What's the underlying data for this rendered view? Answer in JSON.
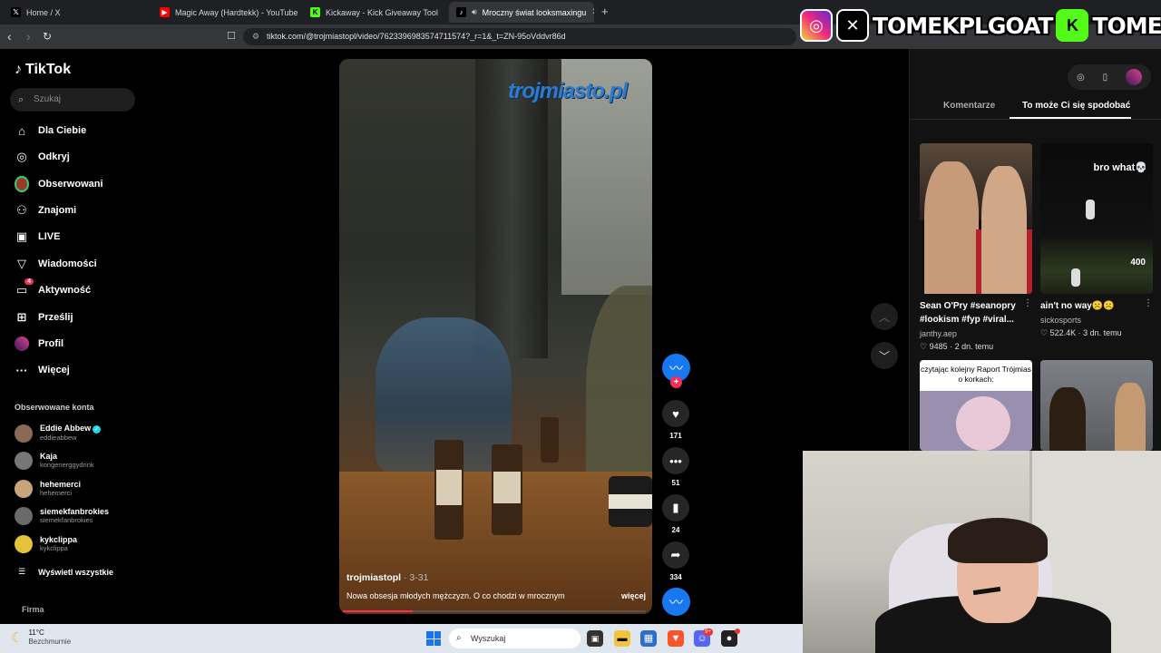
{
  "browser": {
    "tabs": [
      {
        "title": "Home / X",
        "icon": "x-logo-icon",
        "active": false
      },
      {
        "title": "Magic Away (Hardtekk) - YouTube",
        "icon": "youtube-icon",
        "active": false
      },
      {
        "title": "Kickaway - Kick Giveaway Tool",
        "icon": "kick-icon",
        "active": false
      },
      {
        "title": "Mroczny świat looksmaxingu",
        "icon": "tiktok-icon",
        "active": true
      }
    ],
    "url": "tiktok.com/@trojmiastopl/video/7623396983574711574?_r=1&_t=ZN-95oVddvr86d"
  },
  "overlay": {
    "name_x": "TOMEKPLGOAT",
    "name_kick": "TOMEKPL",
    "brand_colors": {
      "kick": "#53fc18",
      "instagram": "#ee2a7b"
    }
  },
  "sidebar": {
    "logo": "TikTok",
    "search_placeholder": "Szukaj",
    "nav": [
      {
        "label": "Dla Ciebie",
        "icon": "home-icon"
      },
      {
        "label": "Odkryj",
        "icon": "compass-icon"
      },
      {
        "label": "Obserwowani",
        "icon": "avatar-icon"
      },
      {
        "label": "Znajomi",
        "icon": "friends-icon"
      },
      {
        "label": "LIVE",
        "icon": "live-icon"
      },
      {
        "label": "Wiadomości",
        "icon": "send-icon"
      },
      {
        "label": "Aktywność",
        "icon": "inbox-icon",
        "badge": "4"
      },
      {
        "label": "Prześlij",
        "icon": "upload-icon"
      },
      {
        "label": "Profil",
        "icon": "profile-icon"
      },
      {
        "label": "Więcej",
        "icon": "more-icon"
      }
    ],
    "followed_title": "Obserwowane konta",
    "accounts": [
      {
        "name": "Eddie Abbew",
        "handle": "eddieabbew",
        "verified": true
      },
      {
        "name": "Kaja",
        "handle": "kongenerggydrink"
      },
      {
        "name": "hehemerci",
        "handle": "hehemerci"
      },
      {
        "name": "siemekfanbrokies",
        "handle": "siemekfanbrokies"
      },
      {
        "name": "kykclippa",
        "handle": "kykclippa"
      }
    ],
    "show_all": "Wyświetl wszystkie",
    "firma": "Firma"
  },
  "video": {
    "watermark": "trojmiasto.pl",
    "author": "trojmiastopl",
    "date": "· 3-31",
    "description": "Nowa obsesja młodych mężczyzn. O co chodzi w mrocznym",
    "more": "więcej",
    "progress": 0.23
  },
  "actions": {
    "likes": "171",
    "comments": "51",
    "saves": "24",
    "shares": "334"
  },
  "right_panel": {
    "tabs": [
      "Komentarze",
      "To może Ci się spodobać"
    ],
    "active_tab": 1,
    "videos": [
      {
        "caption": "Sean O'Pry #seanopry #lookism #fyp #viral...",
        "author": "janthy.aep",
        "likes": "9485",
        "age": "2 dn. temu"
      },
      {
        "caption": "ain't no way☹️☹️",
        "overlay_text": "bro what💀",
        "score": "400",
        "author": "sickosports",
        "likes": "522.4K",
        "age": "3 dn. temu"
      },
      {
        "overlay_text": "czytając kolejny Raport Trójmias o korkach:"
      },
      {}
    ]
  },
  "taskbar": {
    "temp": "11°C",
    "condition": "Bezchmurnie",
    "search_placeholder": "Wyszukaj",
    "discord_badge": "9+"
  }
}
